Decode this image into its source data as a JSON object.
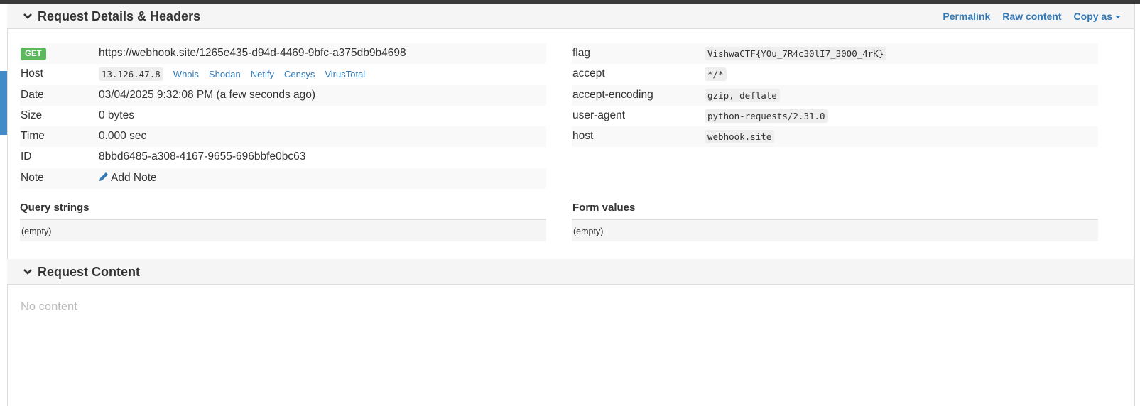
{
  "request_details": {
    "title": "Request Details & Headers",
    "links": {
      "permalink": "Permalink",
      "raw_content": "Raw content",
      "copy_as": "Copy as"
    },
    "method": "GET",
    "url": "https://webhook.site/1265e435-d94d-4469-9bfc-a375db9b4698",
    "host_label": "Host",
    "host_ip": "13.126.47.8",
    "host_tools": [
      "Whois",
      "Shodan",
      "Netify",
      "Censys",
      "VirusTotal"
    ],
    "date_label": "Date",
    "date_value": "03/04/2025 9:32:08 PM (a few seconds ago)",
    "size_label": "Size",
    "size_value": "0 bytes",
    "time_label": "Time",
    "time_value": "0.000 sec",
    "id_label": "ID",
    "id_value": "8bbd6485-a308-4167-9655-696bbfe0bc63",
    "note_label": "Note",
    "note_link": "Add Note"
  },
  "headers": [
    {
      "name": "flag",
      "value": "VishwaCTF{Y0u_7R4c30lI7_3000_4rK}"
    },
    {
      "name": "accept",
      "value": "*/*"
    },
    {
      "name": "accept-encoding",
      "value": "gzip, deflate"
    },
    {
      "name": "user-agent",
      "value": "python-requests/2.31.0"
    },
    {
      "name": "host",
      "value": "webhook.site"
    }
  ],
  "query_strings": {
    "title": "Query strings",
    "value": "(empty)"
  },
  "form_values": {
    "title": "Form values",
    "value": "(empty)"
  },
  "request_content": {
    "title": "Request Content",
    "body": "No content"
  },
  "colors": {
    "accent": "#337ab7",
    "get_badge": "#5cb85c",
    "header_bg": "#f5f5f5"
  },
  "icons": {
    "collapse": "chevron-down-icon",
    "note": "pencil-icon",
    "dropdown": "caret-down-icon"
  }
}
